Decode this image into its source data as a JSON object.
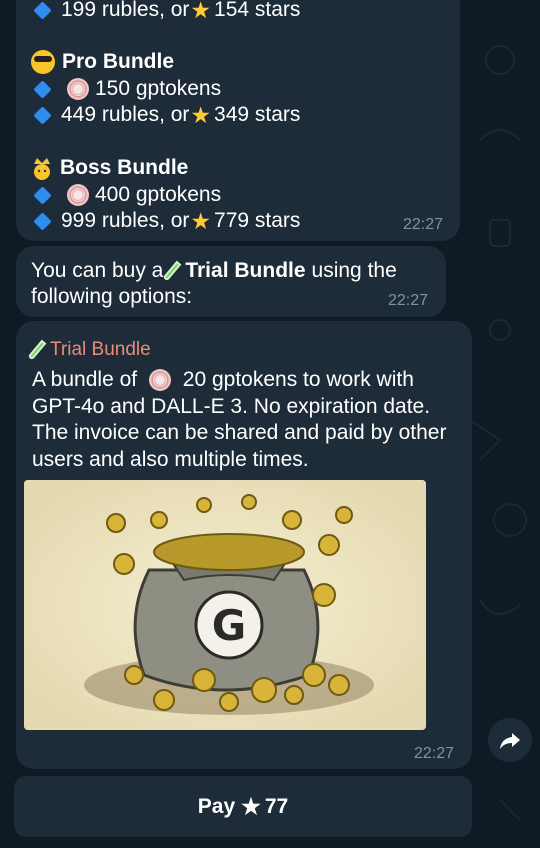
{
  "message1": {
    "line_top_price": "199 rubles, or",
    "line_top_stars": "154 stars",
    "pro_title": "Pro Bundle",
    "pro_tokens": "150 gptokens",
    "pro_price": "449 rubles, or",
    "pro_stars": "349 stars",
    "boss_title": "Boss Bundle",
    "boss_tokens": "400 gptokens",
    "boss_price": "999 rubles, or",
    "boss_stars": "779 stars",
    "time": "22:27"
  },
  "message2": {
    "prefix": "You can buy a",
    "bundle": "Trial Bundle",
    "suffix": "using the",
    "line2": "following options:",
    "time": "22:27"
  },
  "invoice": {
    "title": "Trial Bundle",
    "text_prefix": "A bundle of",
    "text_rest": "20 gptokens to work with GPT-4o and DALL-E 3. No expiration date. The invoice can be shared and paid by other users and also multiple times.",
    "image_letter": "G",
    "time": "22:27"
  },
  "pay_button": {
    "prefix": "Pay",
    "amount": "77"
  },
  "icons": {
    "share": "share-arrow-icon",
    "star": "star-icon",
    "diamond": "blue-diamond-icon",
    "token": "gptoken-icon"
  },
  "colors": {
    "background": "#0f1a24",
    "bubble": "#1e2c3a",
    "accent_title": "#e88b7c",
    "timestamp": "#7f93a6",
    "diamond": "#2f8cf0",
    "star": "#ffcc33"
  }
}
